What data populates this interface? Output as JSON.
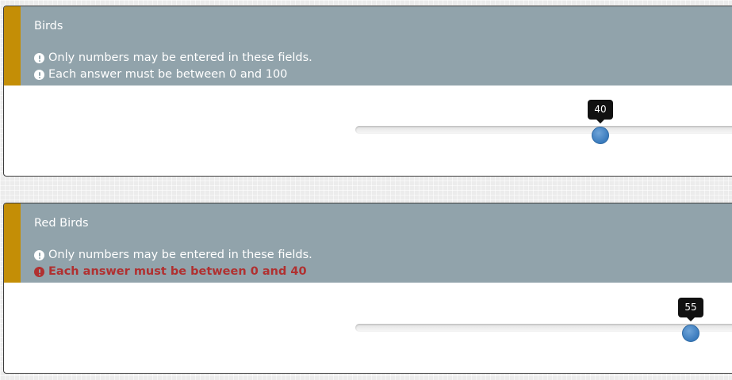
{
  "questions": [
    {
      "title": "Birds",
      "instructions": [
        {
          "text": "Only numbers may be entered in these fields.",
          "error": false,
          "icon": "exclamation-circle-icon"
        },
        {
          "text": "Each answer must be between 0 and 100",
          "error": false,
          "icon": "exclamation-circle-icon"
        }
      ],
      "slider": {
        "value": 40,
        "min": 0,
        "max": 100,
        "tooltip": "40"
      }
    },
    {
      "title": "Red Birds",
      "instructions": [
        {
          "text": "Only numbers may be entered in these fields.",
          "error": false,
          "icon": "exclamation-circle-icon"
        },
        {
          "text": "Each answer must be between 0 and 40",
          "error": true,
          "icon": "exclamation-circle-icon"
        }
      ],
      "slider": {
        "value": 55,
        "min": 0,
        "max": 100,
        "tooltip": "55"
      }
    }
  ],
  "colors": {
    "header_bg": "#91a3ab",
    "accent_bar": "#c48e06",
    "error_text": "#b03030",
    "slider_handle": "#3a7bbd",
    "tooltip_bg": "#111111"
  }
}
